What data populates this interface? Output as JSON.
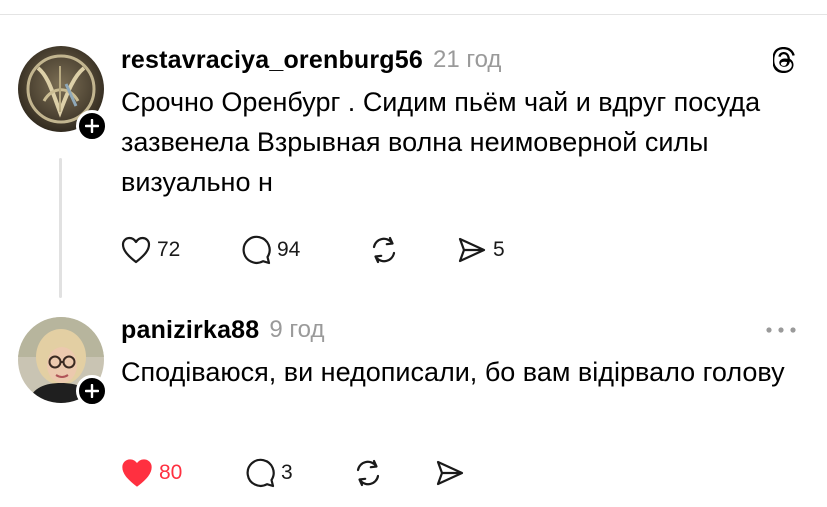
{
  "posts": [
    {
      "username": "restavraciya_orenburg56",
      "time": "21 год",
      "text": "Срочно Оренбург . Сидим пьём чай и вдруг посуда зазвенела Взрывная волна неимоверной силы визуально н",
      "likes": "72",
      "comments": "94",
      "reposts": "",
      "shares": "5",
      "liked": false,
      "corner_icon": "threads-logo-icon",
      "avatar": "vintage-monogram-avatar"
    },
    {
      "username": "panizirka88",
      "time": "9 год",
      "text": "Сподіваюся, ви недописали, бо вам відірвало голову",
      "likes": "80",
      "comments": "3",
      "reposts": "",
      "shares": "",
      "liked": true,
      "corner_icon": "more-options-icon",
      "avatar": "woman-with-glasses-avatar"
    }
  ],
  "colors": {
    "like_active": "#ff3040",
    "muted": "#9a9a9a",
    "divider": "#e4e4e4"
  }
}
